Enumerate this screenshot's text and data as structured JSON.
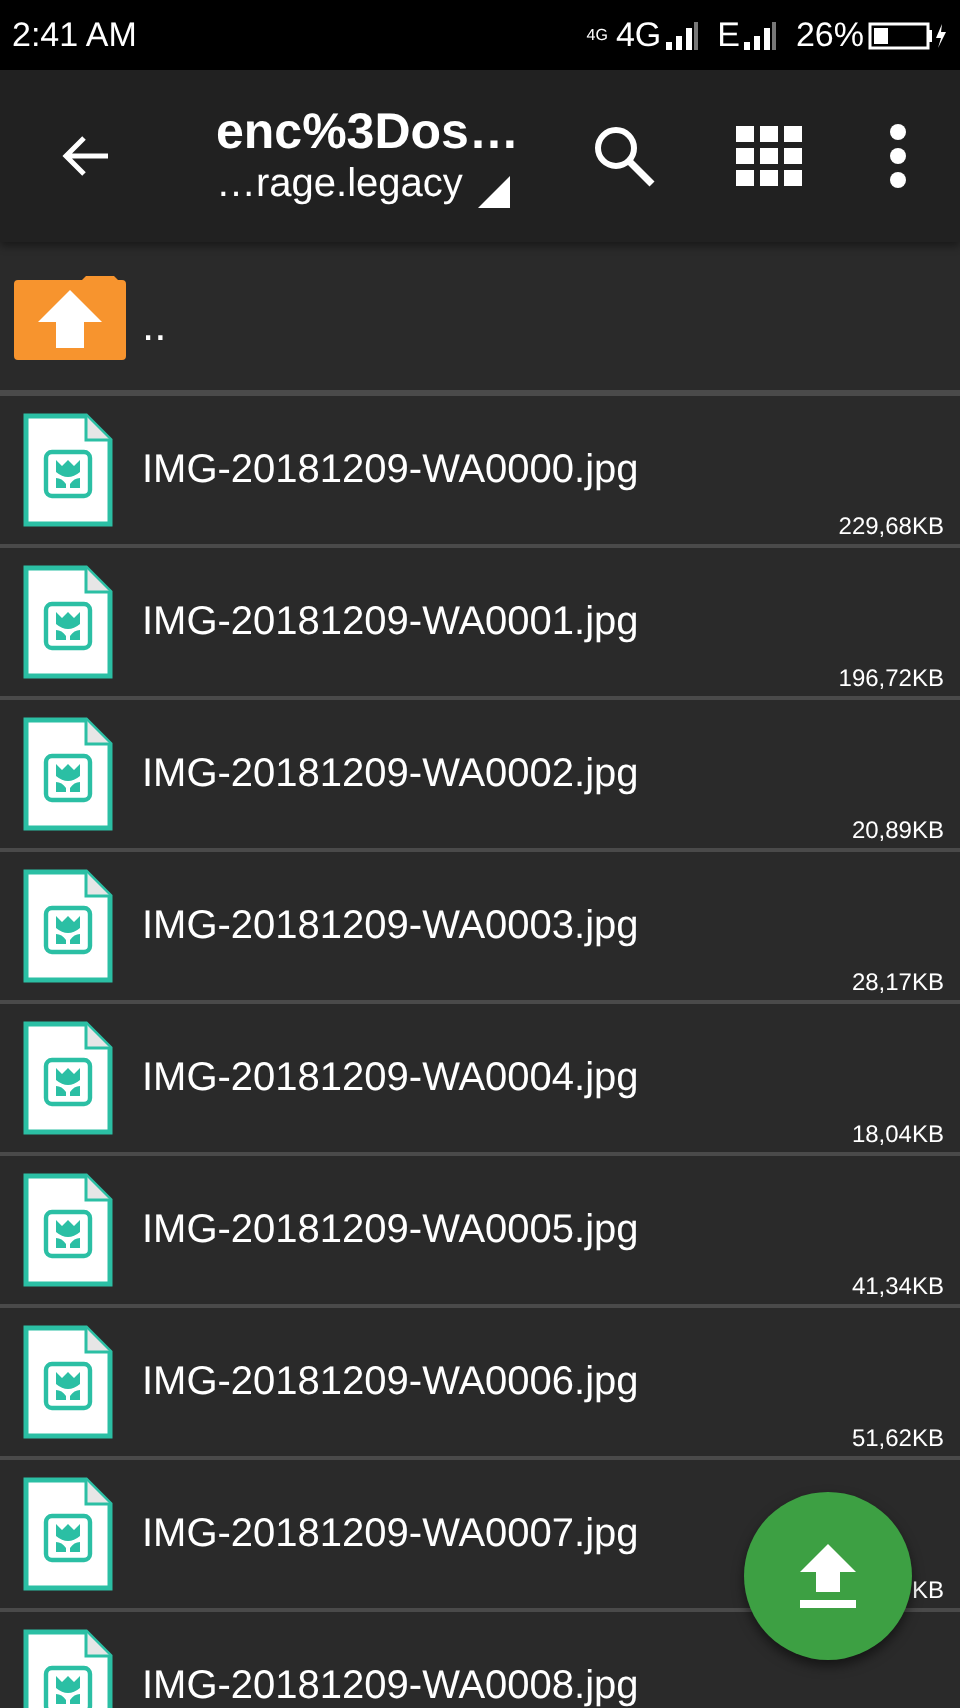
{
  "status_bar": {
    "time": "2:41 AM",
    "network_small": "4G",
    "network": "4G",
    "network2": "E",
    "battery": "26%"
  },
  "toolbar": {
    "title": "enc%3Dos…",
    "subtitle": "…rage.legacy"
  },
  "parent_row": {
    "label": ".."
  },
  "files": [
    {
      "name": "IMG-20181209-WA0000.jpg",
      "size": "229,68KB"
    },
    {
      "name": "IMG-20181209-WA0001.jpg",
      "size": "196,72KB"
    },
    {
      "name": "IMG-20181209-WA0002.jpg",
      "size": "20,89KB"
    },
    {
      "name": "IMG-20181209-WA0003.jpg",
      "size": "28,17KB"
    },
    {
      "name": "IMG-20181209-WA0004.jpg",
      "size": "18,04KB"
    },
    {
      "name": "IMG-20181209-WA0005.jpg",
      "size": "41,34KB"
    },
    {
      "name": "IMG-20181209-WA0006.jpg",
      "size": "51,62KB"
    },
    {
      "name": "IMG-20181209-WA0007.jpg",
      "size": "KB"
    },
    {
      "name": "IMG-20181209-WA0008.jpg"
    }
  ]
}
